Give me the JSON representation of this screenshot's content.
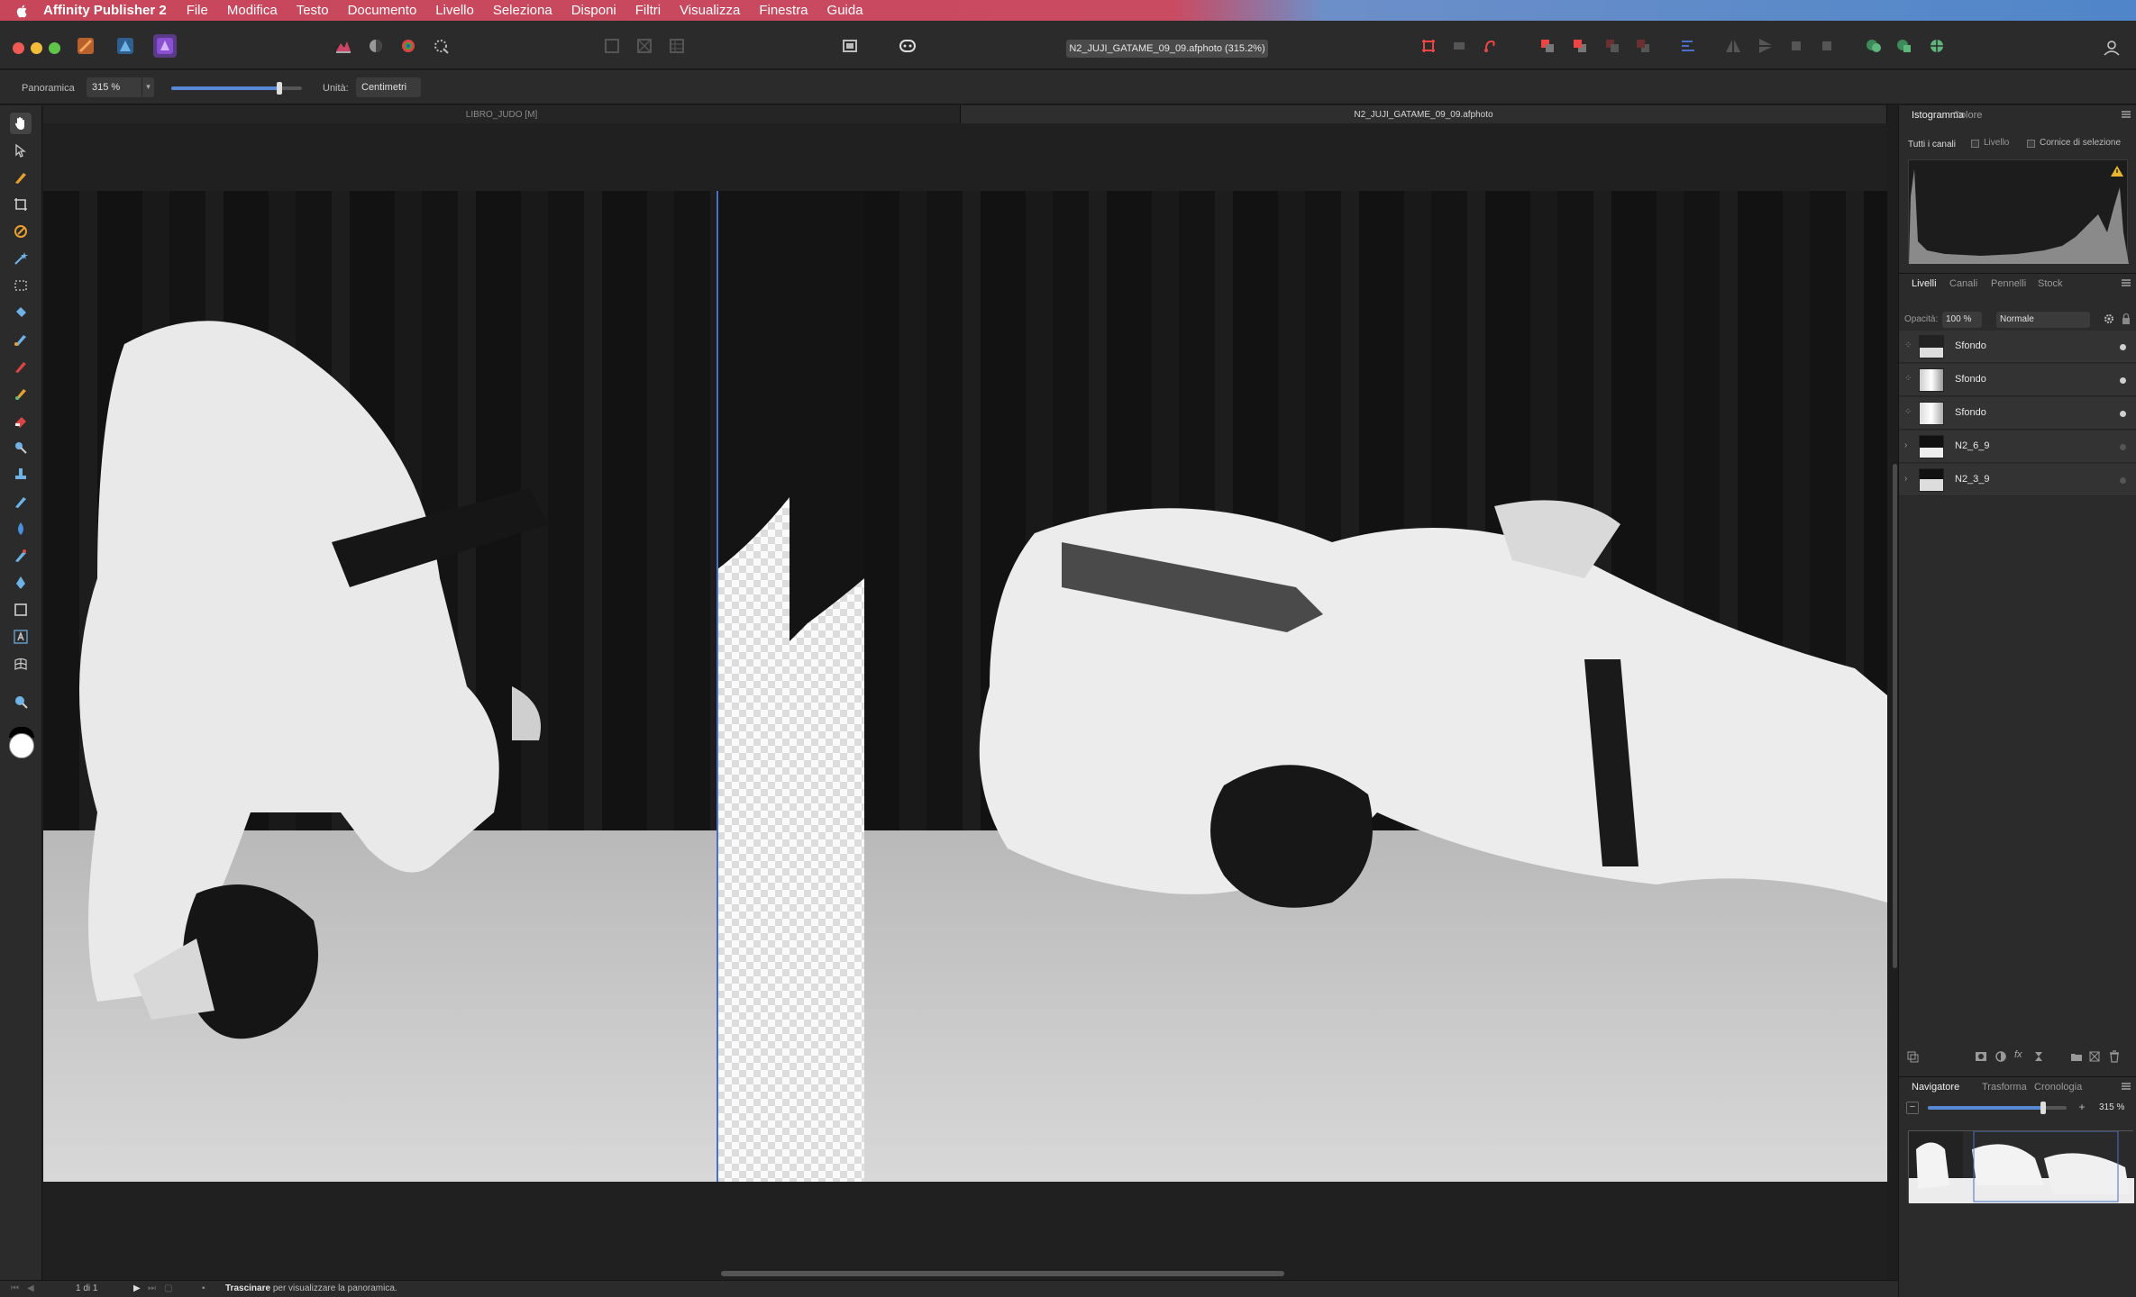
{
  "menubar": {
    "app_name": "Affinity Publisher 2",
    "items": [
      "File",
      "Modifica",
      "Testo",
      "Documento",
      "Livello",
      "Seleziona",
      "Disponi",
      "Filtri",
      "Visualizza",
      "Finestra",
      "Guida"
    ]
  },
  "toolbar": {
    "document_title": "N2_JUJI_GATAME_09_09.afphoto (315.2%)"
  },
  "context_bar": {
    "tool_name": "Panoramica",
    "zoom_value": "315 %",
    "unit_label": "Unità:",
    "unit_value": "Centimetri",
    "zoom_slider_fraction": 0.83
  },
  "document_tabs": [
    {
      "label": "LIBRO_JUDO [M]",
      "active": false
    },
    {
      "label": "N2_JUJI_GATAME_09_09.afphoto",
      "active": true
    }
  ],
  "status_bar": {
    "pager": "1 di 1",
    "hint_bold": "Trascinare",
    "hint_rest": " per visualizzare la panoramica."
  },
  "panels": {
    "histogram": {
      "tabs": [
        "Istogramma",
        "Colore"
      ],
      "channel": "Tutti i canali",
      "opt_layer": "Livello",
      "opt_selection": "Cornice di selezione"
    },
    "layers": {
      "tabs": [
        "Livelli",
        "Canali",
        "Pennelli",
        "Stock"
      ],
      "opacity_label": "Opacità:",
      "opacity_value": "100 %",
      "blend_mode": "Normale",
      "items": [
        {
          "name": "Sfondo",
          "selected": true,
          "visible": true
        },
        {
          "name": "Sfondo",
          "selected": false,
          "visible": true
        },
        {
          "name": "Sfondo",
          "selected": false,
          "visible": true
        },
        {
          "name": "N2_6_9",
          "selected": false,
          "visible": false
        },
        {
          "name": "N2_3_9",
          "selected": false,
          "visible": false
        }
      ]
    },
    "navigator": {
      "tabs": [
        "Navigatore",
        "Trasforma",
        "Cronologia"
      ],
      "zoom_value": "315 %",
      "zoom_slider_fraction": 0.83
    }
  },
  "colors": {
    "accent": "#4a6ec9",
    "selected_layer": "#3f5a8d",
    "panel_bg": "#2b2b2b"
  }
}
